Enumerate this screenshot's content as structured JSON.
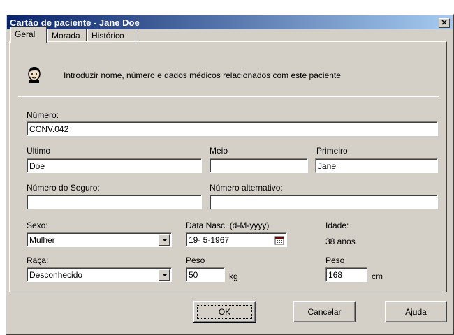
{
  "window": {
    "title": "Cartão de paciente - Jane Doe",
    "close_label": "✕"
  },
  "tabs": [
    {
      "label": "Geral",
      "active": true
    },
    {
      "label": "Morada",
      "active": false
    },
    {
      "label": "Histórico",
      "active": false
    }
  ],
  "info": {
    "icon": "person-head-icon",
    "text": "Introduzir nome, número e dados médicos relacionados com este paciente"
  },
  "form": {
    "numero_label": "Número:",
    "numero_value": "CCNV.042",
    "ultimo_label": "Ultimo",
    "ultimo_value": "Doe",
    "meio_label": "Meio",
    "meio_value": "",
    "primeiro_label": "Primeiro",
    "primeiro_value": "Jane",
    "seguro_label": "Número do Seguro:",
    "seguro_value": "",
    "alternativo_label": "Número alternativo:",
    "alternativo_value": "",
    "sexo_label": "Sexo:",
    "sexo_value": "Mulher",
    "data_label": "Data Nasc.  (d-M-yyyy)",
    "data_value": "19- 5-1967",
    "idade_label": "Idade:",
    "idade_value": "38 anos",
    "raca_label": "Raça:",
    "raca_value": "Desconhecido",
    "peso_label": "Peso",
    "peso_value": "50",
    "peso_unit": "kg",
    "altura_label": "Peso",
    "altura_value": "168",
    "altura_unit": "cm"
  },
  "buttons": {
    "ok": "OK",
    "cancel": "Cancelar",
    "help": "Ajuda"
  },
  "colors": {
    "face": "#d4d0c8",
    "title_start": "#0a246a",
    "title_end": "#a6caf0"
  }
}
